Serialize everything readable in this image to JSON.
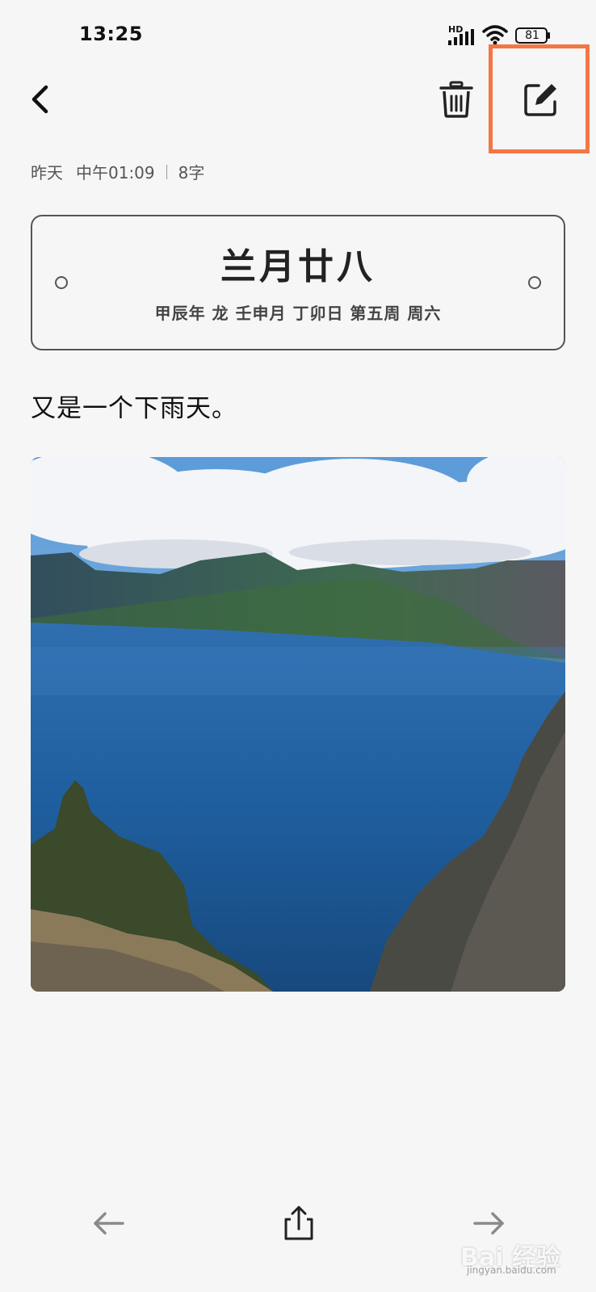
{
  "status_bar": {
    "time": "13:25",
    "network": "HD",
    "battery": "81",
    "icons": [
      "signal-icon",
      "wifi-icon",
      "battery-icon"
    ]
  },
  "toolbar": {
    "back_icon": "chevron-left-icon",
    "delete_icon": "trash-icon",
    "edit_icon": "edit-icon",
    "highlight_color": "#f37744"
  },
  "meta": {
    "day": "昨天",
    "time": "中午01:09",
    "word_count": "8字"
  },
  "date_card": {
    "lunar_date": "兰月廿八",
    "ganzhi": "甲辰年 龙 壬申月 丁卯日 第五周 周六"
  },
  "note": {
    "text": "又是一个下雨天。"
  },
  "photo": {
    "subject": "crater-lake-photo"
  },
  "bottom_nav": {
    "prev_icon": "arrow-left-icon",
    "share_icon": "share-icon",
    "next_icon": "arrow-right-icon"
  },
  "watermark": {
    "text": "Bai 经验",
    "sub": "jingyan.baidu.com"
  }
}
